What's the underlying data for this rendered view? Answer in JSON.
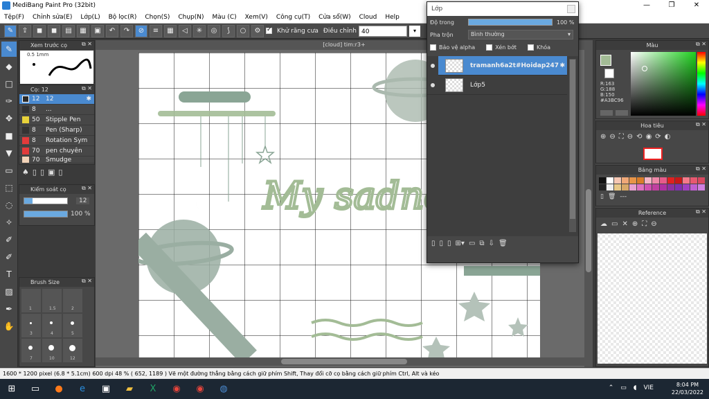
{
  "window": {
    "title": "MediBang Paint Pro (32bit)",
    "min": "—",
    "max": "❐",
    "close": "✕"
  },
  "menu": [
    "Tệp(F)",
    "Chỉnh sửa(E)",
    "Lớp(L)",
    "Bộ lọc(R)",
    "Chọn(S)",
    "Chụp(N)",
    "Màu (C)",
    "Xem(V)",
    "Công cụ(T)",
    "Cửa sổ(W)",
    "Cloud",
    "Help"
  ],
  "toolbar": {
    "antialias_label": "Khử răng cưa",
    "adjust_label": "Điều chỉnh",
    "adjust_value": "40"
  },
  "brush_preview": {
    "title": "Xem trước cọ",
    "size_label": "0.5 1mm"
  },
  "brushes": {
    "title": "Cọ: 12",
    "items": [
      {
        "size": "12",
        "name": "12",
        "color": "#ffffff"
      },
      {
        "size": "8",
        "name": "...",
        "color": "#333333"
      },
      {
        "size": "50",
        "name": "Stipple Pen",
        "color": "#e8d23a"
      },
      {
        "size": "8",
        "name": "Pen (Sharp)",
        "color": "#333333"
      },
      {
        "size": "8",
        "name": "Rotation Sym",
        "color": "#e23b3b"
      },
      {
        "size": "70",
        "name": "pen chuyên",
        "color": "#e23b3b"
      },
      {
        "size": "70",
        "name": "Smudge",
        "color": "#f3d3b8"
      }
    ]
  },
  "brush_control": {
    "title": "Kiểm soát cọ",
    "size_value": "12",
    "opacity_value": "100 %",
    "opacity_fraction": 1.0
  },
  "brush_size": {
    "title": "Brush Size",
    "labels": [
      "1",
      "1.5",
      "2",
      "3",
      "4",
      "5",
      "7",
      "10",
      "12"
    ]
  },
  "document": {
    "tab": "[cloud] tim:r3+"
  },
  "canvas_text": "My sadness",
  "layer_window": {
    "title": "Lớp",
    "opacity_label": "Độ trong",
    "opacity_value": "100 %",
    "blend_label": "Pha trộn",
    "blend_value": "Bình thường",
    "protect_alpha": "Bảo vệ alpha",
    "clipping": "Xén bớt",
    "lock": "Khóa",
    "layers": [
      {
        "name": "tramanh6a2t#Hoidap247",
        "selected": true
      },
      {
        "name": "Lớp5",
        "selected": false
      }
    ]
  },
  "color_panel": {
    "title": "Màu",
    "r": "R:163",
    "g": "G:188",
    "b": "B:150",
    "hex": "#A3BC96",
    "primary": "#a3bc96"
  },
  "navigator": {
    "title": "Hoa tiêu"
  },
  "swatch_panel": {
    "title": "Bảng màu",
    "value": "---"
  },
  "reference": {
    "title": "Reference"
  },
  "status": {
    "text": "1600 * 1200 pixel  (6.8 * 5.1cm)  600 dpi  48 %  ( 652, 1189 )  Vẽ một đường thẳng bằng cách giữ phím Shift, Thay đổi cỡ cọ bằng cách giữ phím Ctrl, Alt và kéo"
  },
  "taskbar": {
    "lang": "VIE",
    "time": "8:04 PM",
    "date": "22/03/2022"
  },
  "colors": {
    "accent": "#4a8ad0",
    "drawing": "#a3bc96"
  }
}
